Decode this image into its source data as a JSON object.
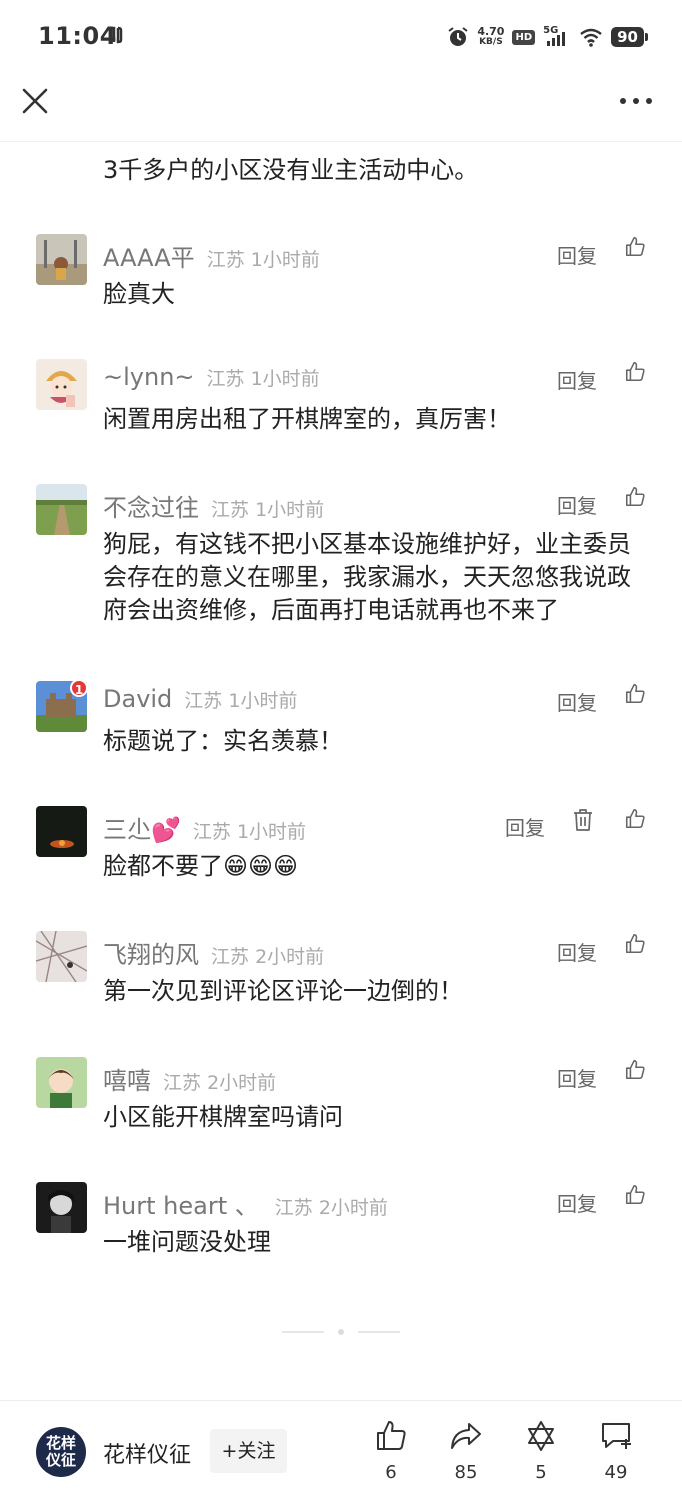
{
  "status_bar": {
    "time": "11:04",
    "net_speed_value": "4.70",
    "net_speed_unit": "KB/S",
    "hd": "HD",
    "network": "5G",
    "battery": "90"
  },
  "previous_comment_text": "3千多户的小区没有业主活动中心。",
  "reply_label": "回复",
  "comments": [
    {
      "name": "AAAA平",
      "location": "江苏",
      "time": "1小时前",
      "text": "脸真大"
    },
    {
      "name": "~lynn~",
      "location": "江苏",
      "time": "1小时前",
      "text": "闲置用房出租了开棋牌室的，真厉害！"
    },
    {
      "name": "不念过往",
      "location": "江苏",
      "time": "1小时前",
      "text": "狗屁，有这钱不把小区基本设施维护好，业主委员会存在的意义在哪里，我家漏水，天天忽悠我说政府会出资维修，后面再打电话就再也不来了"
    },
    {
      "name": "David",
      "location": "江苏",
      "time": "1小时前",
      "text": "标题说了：实名羡慕！",
      "badge": "1"
    },
    {
      "name": "三尐💕",
      "location": "江苏",
      "time": "1小时前",
      "text": "脸都不要了😁😁😁"
    },
    {
      "name": "飞翔的风",
      "location": "江苏",
      "time": "2小时前",
      "text": "第一次见到评论区评论一边倒的！"
    },
    {
      "name": "嘻嘻",
      "location": "江苏",
      "time": "2小时前",
      "text": "小区能开棋牌室吗请问"
    },
    {
      "name": "Hurt heart 、",
      "location": "江苏",
      "time": "2小时前",
      "text": "一堆问题没处理"
    }
  ],
  "bottom_bar": {
    "author_avatar_text": "花样仪征",
    "author_name": "花样仪征",
    "follow_label": "+关注",
    "like_count": "6",
    "share_count": "85",
    "collect_count": "5",
    "comment_count": "49"
  },
  "icons": {
    "close": "close-icon",
    "more": "more-icon",
    "like": "thumbs-up-icon",
    "delete": "trash-icon",
    "share": "share-icon",
    "collect": "star-of-david-icon",
    "comment": "comment-plus-icon"
  }
}
